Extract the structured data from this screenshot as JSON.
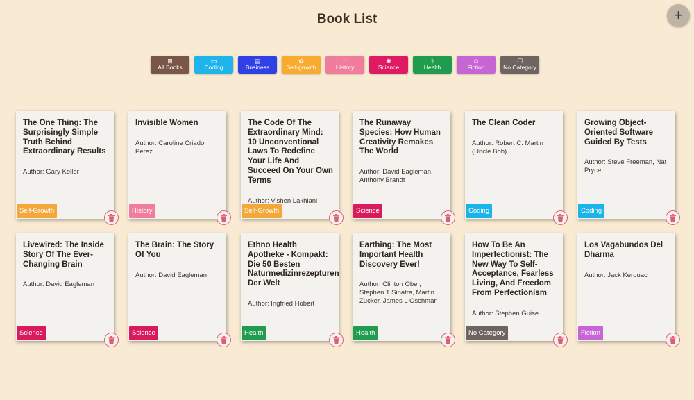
{
  "header": {
    "title": "Book List",
    "add_label": "+"
  },
  "filters": [
    {
      "label": "All Books",
      "icon": "⊞",
      "color": "#7a5649"
    },
    {
      "label": "Coding",
      "icon": "▭",
      "color": "#1fb5ea"
    },
    {
      "label": "Business",
      "icon": "▤",
      "color": "#2f41e5"
    },
    {
      "label": "Self-growth",
      "icon": "✿",
      "color": "#f7ab31"
    },
    {
      "label": "History",
      "icon": "⌂",
      "color": "#f07d9b"
    },
    {
      "label": "Science",
      "icon": "✺",
      "color": "#e01a62"
    },
    {
      "label": "Health",
      "icon": "⚕",
      "color": "#1f9c4d"
    },
    {
      "label": "Fiction",
      "icon": "☺",
      "color": "#c865d5"
    },
    {
      "label": "No Category",
      "icon": "☐",
      "color": "#6e6560"
    }
  ],
  "books": [
    {
      "title": "The One Thing: The Surprisingly Simple Truth Behind Extraordinary Results",
      "author": "Author: Gary Keller",
      "category": "Self-Growth",
      "color": "#f4a83a"
    },
    {
      "title": "Invisible Women",
      "author": "Author: Caroline Criado Perez",
      "category": "History",
      "color": "#ef7d9b"
    },
    {
      "title": "The Code Of The Extraordinary Mind: 10 Unconventional Laws To Redefine Your Life And Succeed On Your Own Terms",
      "author": "Author: Vishen Lakhiani",
      "category": "Self-Growth",
      "color": "#f4a83a"
    },
    {
      "title": "The Runaway Species: How Human Creativity Remakes The World",
      "author": "Author: David Eagleman, Anthony Brandt",
      "category": "Science",
      "color": "#d91a5d"
    },
    {
      "title": "The Clean Coder",
      "author": "Author: Robert C. Martin (Uncle Bob)",
      "category": "Coding",
      "color": "#1ab3ea"
    },
    {
      "title": "Growing Object-Oriented Software Guided By Tests",
      "author": "Author: Steve Freeman, Nat Pryce",
      "category": "Coding",
      "color": "#1ab3ea"
    },
    {
      "title": "Livewired: The Inside Story Of The Ever-Changing Brain",
      "author": "Author: David Eagleman",
      "category": "Science",
      "color": "#d91a5d"
    },
    {
      "title": "The Brain: The Story Of You",
      "author": "Author: David Eagleman",
      "category": "Science",
      "color": "#d91a5d"
    },
    {
      "title": "Ethno Health Apotheke - Kompakt: Die 50 Besten Naturmedizinrezepturen Der Welt",
      "author": "Author: Ingfried Hobert",
      "category": "Health",
      "color": "#1f9c4d"
    },
    {
      "title": "Earthing: The Most Important Health Discovery Ever!",
      "author": "Author: Clinton Ober, Stephen T Sinatra, Martin Zucker, James L Oschman",
      "category": "Health",
      "color": "#1f9c4d"
    },
    {
      "title": "How To Be An Imperfectionist: The New Way To Self-Acceptance, Fearless Living, And Freedom From Perfectionism",
      "author": "Author: Stephen Guise",
      "category": "No Category",
      "color": "#6e6560"
    },
    {
      "title": "Los Vagabundos Del Dharma",
      "author": "Author: Jack Kerouac",
      "category": "Fiction",
      "color": "#c865d5"
    }
  ]
}
